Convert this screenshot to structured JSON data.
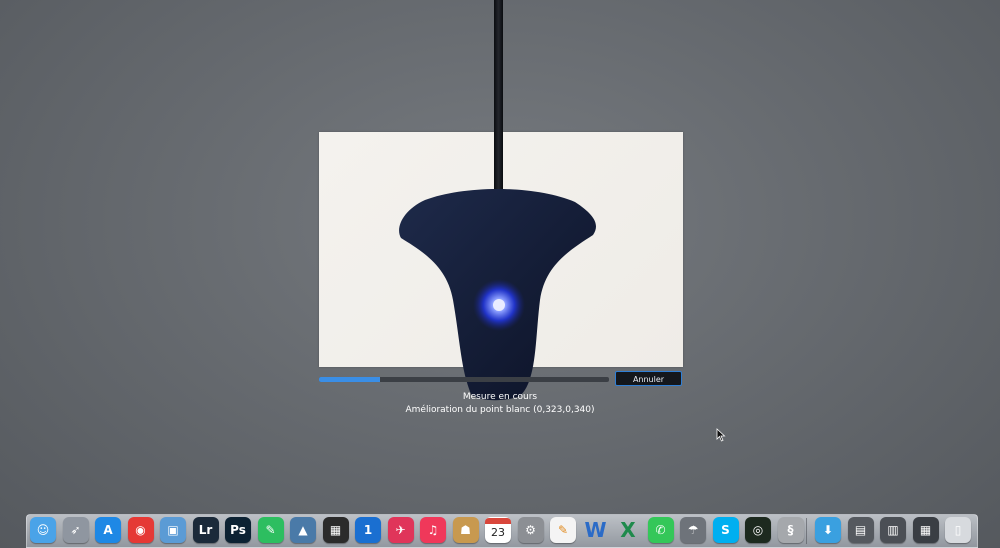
{
  "measurement": {
    "progress_percent": 21,
    "cancel_label": "Annuler",
    "status_line_1": "Mesure en cours",
    "status_line_2": "Amélioration du point blanc (0,323,0,340)"
  },
  "dock": {
    "calendar_day": "23",
    "apps": [
      {
        "name": "Finder",
        "icon": "finder-icon",
        "color": "#4aa3e8"
      },
      {
        "name": "Launchpad",
        "icon": "rocket-icon",
        "color": "#8f96a0"
      },
      {
        "name": "App Store",
        "icon": "app-store-icon",
        "color": "#1e88e5"
      },
      {
        "name": "Chrome",
        "icon": "chrome-icon",
        "color": "#e53935"
      },
      {
        "name": "Preview",
        "icon": "preview-icon",
        "color": "#5b9bd5"
      },
      {
        "name": "Lightroom",
        "icon": "lightroom-icon",
        "color": "#1b2a3a"
      },
      {
        "name": "Photoshop",
        "icon": "photoshop-icon",
        "color": "#0c2233"
      },
      {
        "name": "Evernote",
        "icon": "evernote-icon",
        "color": "#2dbe60"
      },
      {
        "name": "Photo Editor",
        "icon": "photo-icon",
        "color": "#4a7aa8"
      },
      {
        "name": "Final Cut",
        "icon": "clapper-icon",
        "color": "#2b2b2b"
      },
      {
        "name": "1Password",
        "icon": "onepassword-icon",
        "color": "#1a6fd1"
      },
      {
        "name": "Airmail",
        "icon": "airmail-icon",
        "color": "#e0355a"
      },
      {
        "name": "Music",
        "icon": "music-icon",
        "color": "#f0385a"
      },
      {
        "name": "Contacts",
        "icon": "contacts-icon",
        "color": "#c8994f"
      },
      {
        "name": "Calendar",
        "icon": "calendar-icon",
        "color": "#ffffff"
      },
      {
        "name": "System Preferences",
        "icon": "gear-icon",
        "color": "#8c8f94"
      },
      {
        "name": "Pages",
        "icon": "pages-icon",
        "color": "#f4f4f4"
      },
      {
        "name": "Word",
        "icon": "word-icon",
        "color": "#2b6bc7"
      },
      {
        "name": "Excel",
        "icon": "excel-icon",
        "color": "#1f8a4c"
      },
      {
        "name": "FaceTime",
        "icon": "facetime-icon",
        "color": "#34c759"
      },
      {
        "name": "Pilot",
        "icon": "pilot-icon",
        "color": "#6e737a"
      },
      {
        "name": "Skype",
        "icon": "skype-icon",
        "color": "#00aff0"
      },
      {
        "name": "Camera App",
        "icon": "lens-icon",
        "color": "#1d2a1f"
      },
      {
        "name": "Syncios",
        "icon": "syncios-icon",
        "color": "#a5a8ac"
      },
      {
        "name": "Downloads",
        "icon": "downloads-folder-icon",
        "color": "#3aa0e0"
      },
      {
        "name": "Screenshots",
        "icon": "screenshots-icon",
        "color": "#55595f"
      },
      {
        "name": "Photos Stack",
        "icon": "photos-stack-icon",
        "color": "#4b4f55"
      },
      {
        "name": "Movies Stack",
        "icon": "movies-stack-icon",
        "color": "#3a3e44"
      },
      {
        "name": "Trash",
        "icon": "trash-icon",
        "color": "#d7dade"
      }
    ]
  }
}
